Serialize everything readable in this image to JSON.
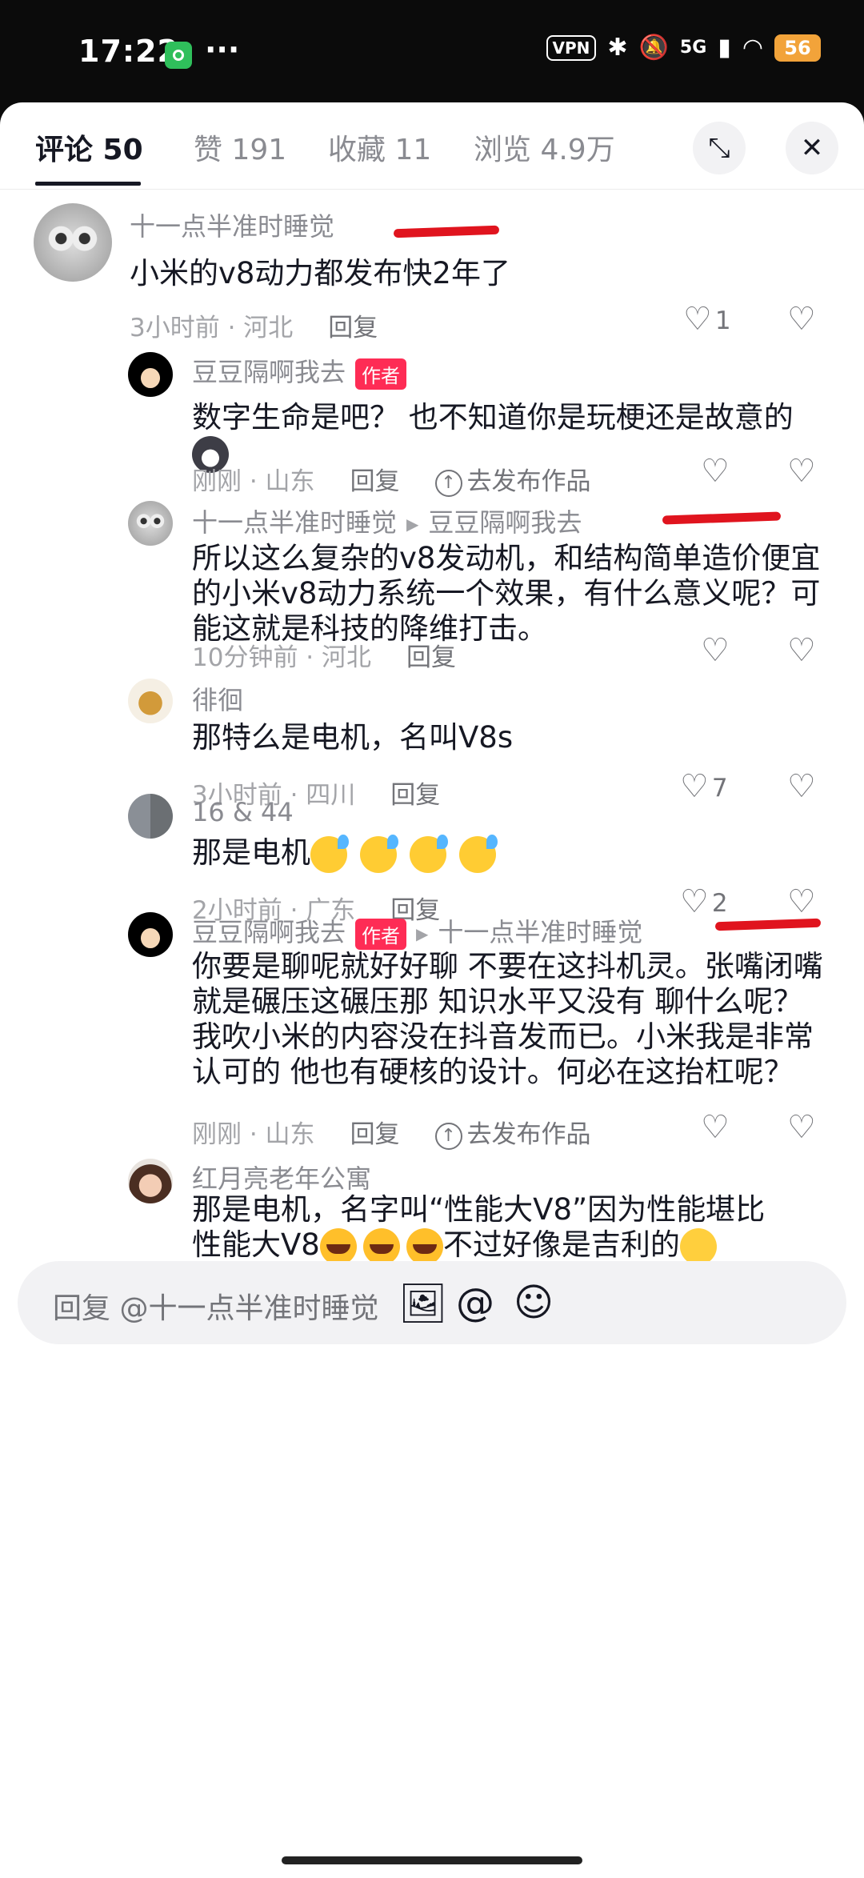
{
  "status": {
    "time": "17:22",
    "vpn": "VPN",
    "net": "5G",
    "battery": "56"
  },
  "tabs": [
    {
      "label": "评论 50",
      "active": true
    },
    {
      "label": "赞 191"
    },
    {
      "label": "收藏 11"
    },
    {
      "label": "浏览 4.9万"
    }
  ],
  "comments": [
    {
      "user": "十一点半准时睡觉",
      "text": "小米的v8动力都发布快2年了",
      "time_loc": "3小时前 · 河北",
      "reply": "回复",
      "likes": "1"
    },
    {
      "user": "豆豆隔啊我去",
      "badge": "作者",
      "text": "数字生命是吧？ 也不知道你是玩梗还是故意的",
      "time_loc": "刚刚 · 山东",
      "reply": "回复",
      "publish": "去发布作品"
    },
    {
      "user": "十一点半准时睡觉",
      "reply_to": "豆豆隔啊我去",
      "text": "所以这么复杂的v8发动机，和结构简单造价便宜的小米v8动力系统一个效果，有什么意义呢？可能这就是科技的降维打击。",
      "time_loc": "10分钟前 · 河北",
      "reply": "回复"
    },
    {
      "user": "徘徊",
      "text": "那特么是电机，名叫V8s",
      "time_loc": "3小时前 · 四川",
      "reply": "回复",
      "likes": "7"
    },
    {
      "user": "16 & 44",
      "text": "那是电机",
      "time_loc": "2小时前 · 广东",
      "reply": "回复",
      "likes": "2"
    },
    {
      "user": "豆豆隔啊我去",
      "badge": "作者",
      "reply_to": "十一点半准时睡觉",
      "text": "你要是聊呢就好好聊 不要在这抖机灵。张嘴闭嘴就是碾压这碾压那 知识水平又没有 聊什么呢？我吹小米的内容没在抖音发而已。小米我是非常认可的 他也有硬核的设计。何必在这抬杠呢？",
      "time_loc": "刚刚 · 山东",
      "reply": "回复",
      "publish": "去发布作品"
    },
    {
      "user": "红月亮老年公寓",
      "text1": "那是电机，名字叫“性能大V8”因为性能堪比",
      "text2a": "性能大V8",
      "text2b": "不过好像是吉利的"
    }
  ],
  "input": {
    "placeholder": "回复 @十一点半准时睡觉"
  }
}
